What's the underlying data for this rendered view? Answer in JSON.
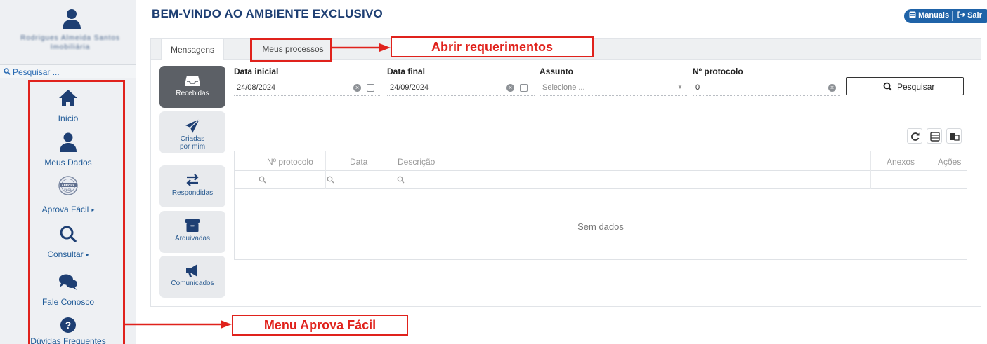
{
  "header": {
    "title": "BEM-VINDO AO AMBIENTE EXCLUSIVO",
    "manuais_label": "Manuais",
    "sair_label": "Sair"
  },
  "sidebar": {
    "user_name": "Rodrigues Almeida Santos Imobiliária",
    "search_placeholder": "Pesquisar ...",
    "items": [
      {
        "label": "Início",
        "icon": "home-icon",
        "has_submenu": false
      },
      {
        "label": "Meus Dados",
        "icon": "user-icon",
        "has_submenu": false
      },
      {
        "label": "Aprova Fácil",
        "icon": "aprova-facil-seal-icon",
        "has_submenu": true
      },
      {
        "label": "Consultar",
        "icon": "search-icon",
        "has_submenu": true
      },
      {
        "label": "Fale Conosco",
        "icon": "chat-bubbles-icon",
        "has_submenu": false
      },
      {
        "label": "Dúvidas Frequentes",
        "icon": "question-circle-icon",
        "has_submenu": false
      }
    ],
    "submenu_arrow": "▸",
    "seal_text": "APROVA FÁCIL"
  },
  "tabs": [
    {
      "label": "Mensagens",
      "active": true
    },
    {
      "label": "Meus processos",
      "active": false
    }
  ],
  "side_buttons": [
    {
      "label": "Recebidas",
      "icon": "inbox-icon",
      "active": true
    },
    {
      "label": "Criadas por mim",
      "icon": "paper-plane-icon",
      "active": false
    },
    {
      "label": "Respondidas",
      "icon": "exchange-arrows-icon",
      "active": false
    },
    {
      "label": "Arquivadas",
      "icon": "archive-icon",
      "active": false
    },
    {
      "label": "Comunicados",
      "icon": "megaphone-icon",
      "active": false
    }
  ],
  "filters": {
    "data_inicial": {
      "label": "Data inicial",
      "value": "24/08/2024"
    },
    "data_final": {
      "label": "Data final",
      "value": "24/09/2024"
    },
    "assunto": {
      "label": "Assunto",
      "placeholder": "Selecione ..."
    },
    "protocolo": {
      "label": "Nº protocolo",
      "value": "0"
    },
    "search_button": "Pesquisar"
  },
  "toolbar_icons": [
    "refresh-icon",
    "column-chooser-icon",
    "export-icon"
  ],
  "grid": {
    "columns": [
      "Nº protocolo",
      "Data",
      "Descrição",
      "Anexos",
      "Ações"
    ],
    "empty_text": "Sem dados"
  },
  "annotations": {
    "requerimentos": "Abrir requerimentos",
    "menu": "Menu Aprova Fácil"
  },
  "colors": {
    "annotation_red": "#e0221c",
    "title_navy": "#1e3f73",
    "link_blue": "#1f5a97",
    "button_blue": "#1f63a8",
    "active_dark": "#5c6066"
  }
}
